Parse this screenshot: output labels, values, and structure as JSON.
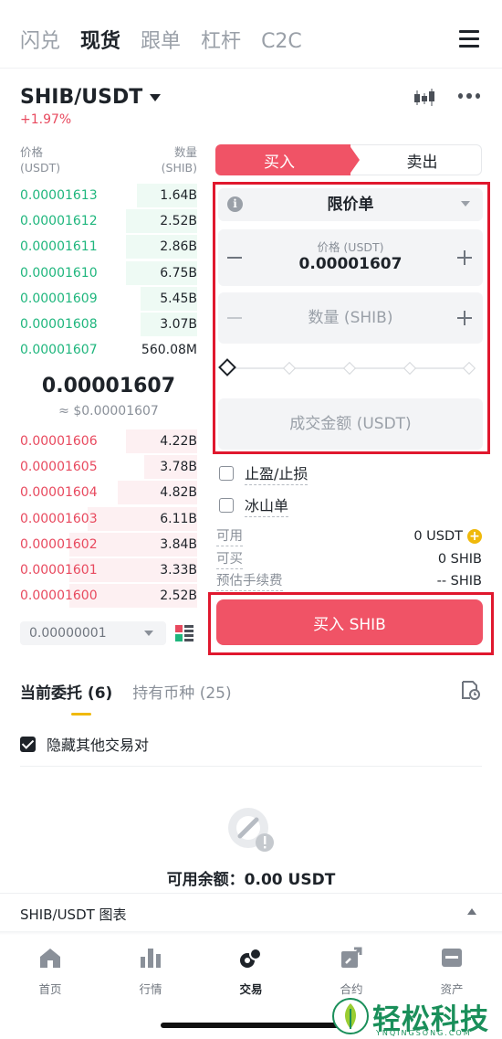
{
  "top_tabs": [
    "闪兑",
    "现货",
    "跟单",
    "杠杆",
    "C2C"
  ],
  "active_top_tab": "现货",
  "pair": {
    "symbol": "SHIB/USDT",
    "change": "+1.97%"
  },
  "orderbook": {
    "price_header": [
      "价格",
      "(USDT)"
    ],
    "qty_header": [
      "数量",
      "(SHIB)"
    ],
    "asks": [
      {
        "price": "0.00001613",
        "qty": "1.64B",
        "depth": 0.34
      },
      {
        "price": "0.00001612",
        "qty": "2.52B",
        "depth": 0.4
      },
      {
        "price": "0.00001611",
        "qty": "2.86B",
        "depth": 0.4
      },
      {
        "price": "0.00001610",
        "qty": "6.75B",
        "depth": 0.4
      },
      {
        "price": "0.00001609",
        "qty": "5.45B",
        "depth": 0.32
      },
      {
        "price": "0.00001608",
        "qty": "3.07B",
        "depth": 0.32
      },
      {
        "price": "0.00001607",
        "qty": "560.08M",
        "depth": 0.0
      }
    ],
    "last_price": "0.00001607",
    "last_price_usd": "≈ $0.00001607",
    "bids": [
      {
        "price": "0.00001606",
        "qty": "4.22B",
        "depth": 0.4
      },
      {
        "price": "0.00001605",
        "qty": "3.78B",
        "depth": 0.3
      },
      {
        "price": "0.00001604",
        "qty": "4.82B",
        "depth": 0.45
      },
      {
        "price": "0.00001603",
        "qty": "6.11B",
        "depth": 0.62
      },
      {
        "price": "0.00001602",
        "qty": "3.84B",
        "depth": 0.72
      },
      {
        "price": "0.00001601",
        "qty": "3.33B",
        "depth": 0.72
      },
      {
        "price": "0.00001600",
        "qty": "2.52B",
        "depth": 0.72
      }
    ],
    "precision": "0.00000001"
  },
  "form": {
    "buy_tab": "买入",
    "sell_tab": "卖出",
    "order_type": "限价单",
    "price_label": "价格 (USDT)",
    "price_value": "0.00001607",
    "qty_placeholder": "数量 (SHIB)",
    "total_placeholder": "成交金额 (USDT)",
    "tp_sl": "止盈/止损",
    "iceberg": "冰山单",
    "available_label": "可用",
    "available_value": "0 USDT",
    "max_buy_label": "可买",
    "max_buy_value": "0 SHIB",
    "fee_label": "预估手续费",
    "fee_value": "-- SHIB",
    "buy_button": "买入 SHIB"
  },
  "orders": {
    "tab_open": "当前委托 (6)",
    "tab_holdings": "持有币种 (25)",
    "hide_other": "隐藏其他交易对",
    "balance": "可用余额：0.00 USDT"
  },
  "chart_bar": "SHIB/USDT 图表",
  "nav": [
    "首页",
    "行情",
    "交易",
    "合约",
    "资产"
  ],
  "watermark": {
    "text": "轻松科技",
    "sub": "YNQINGSONG.COM"
  },
  "colors": {
    "buy": "#f05366",
    "green": "#1fb67d",
    "red": "#e8495e",
    "accent": "#f0b90b"
  }
}
